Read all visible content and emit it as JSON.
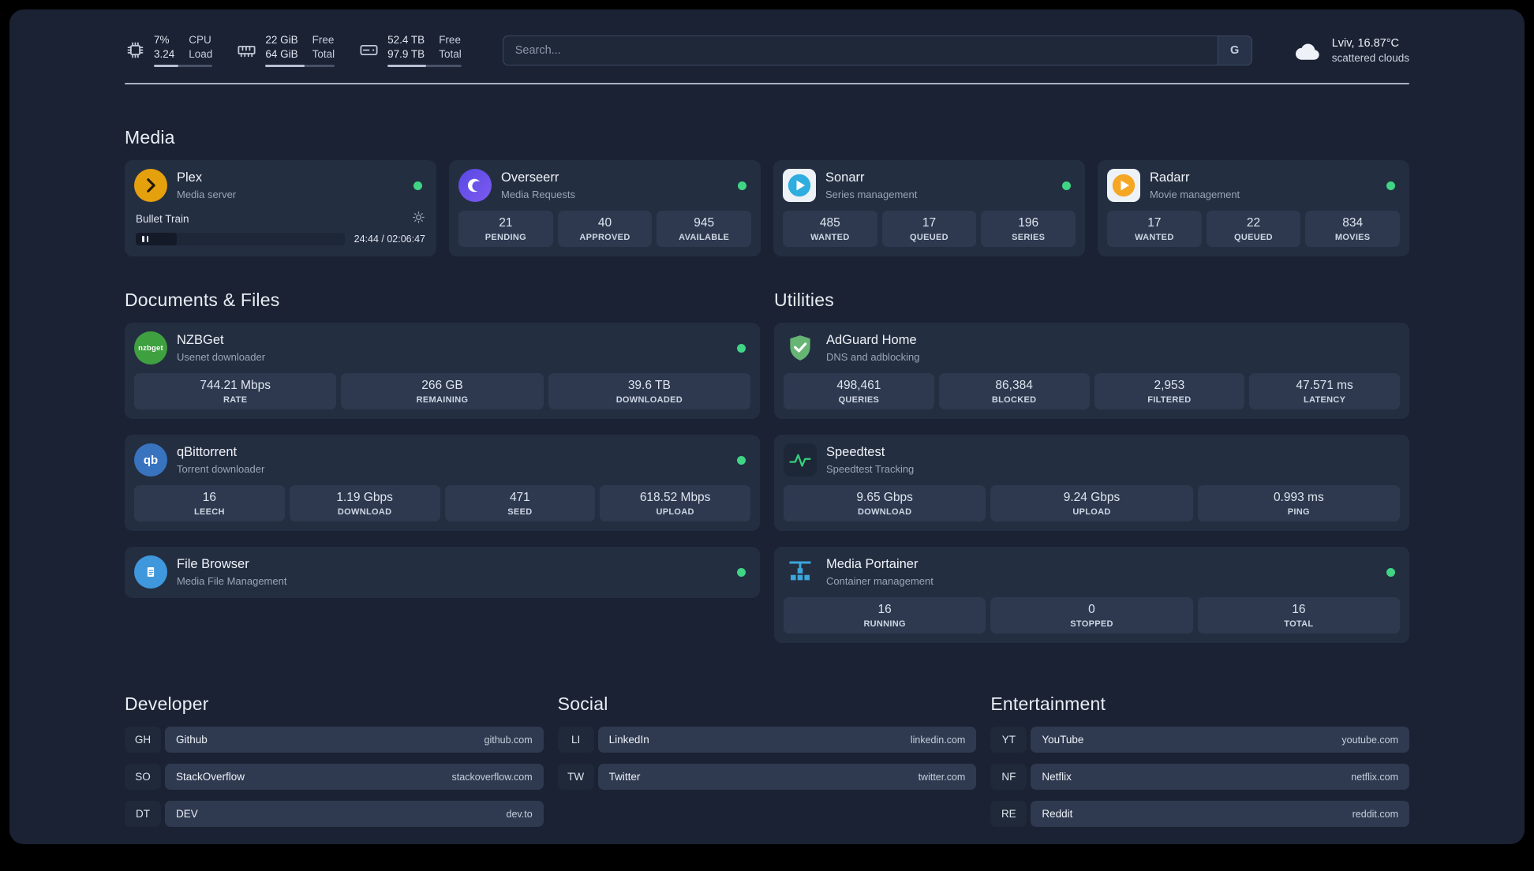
{
  "colors": {
    "status_online": "#3fd584",
    "background": "#1a2233",
    "card": "#242e41",
    "stat_tile": "#2e3950",
    "plex_accent": "#e5a00d"
  },
  "topbar": {
    "cpu": {
      "percent": "7%",
      "load": "3.24",
      "label_line1": "CPU",
      "label_line2": "Load",
      "bar_pct": 42
    },
    "memory": {
      "free": "22 GiB",
      "total": "64 GiB",
      "label_line1": "Free",
      "label_line2": "Total",
      "bar_pct": 57
    },
    "disk": {
      "free": "52.4 TB",
      "total": "97.9 TB",
      "label_line1": "Free",
      "label_line2": "Total",
      "bar_pct": 52
    },
    "search": {
      "placeholder": "Search...",
      "engine_button": "G"
    },
    "weather": {
      "location": "Lviv, 16.87°C",
      "condition": "scattered clouds"
    }
  },
  "sections": {
    "media": {
      "title": "Media",
      "plex": {
        "name": "Plex",
        "desc": "Media server",
        "now_playing": "Bullet Train",
        "time": "24:44 / 02:06:47",
        "progress_pct": 19.5
      },
      "overseerr": {
        "name": "Overseerr",
        "desc": "Media Requests",
        "stats": [
          {
            "value": "21",
            "label": "PENDING"
          },
          {
            "value": "40",
            "label": "APPROVED"
          },
          {
            "value": "945",
            "label": "AVAILABLE"
          }
        ]
      },
      "sonarr": {
        "name": "Sonarr",
        "desc": "Series management",
        "stats": [
          {
            "value": "485",
            "label": "WANTED"
          },
          {
            "value": "17",
            "label": "QUEUED"
          },
          {
            "value": "196",
            "label": "SERIES"
          }
        ]
      },
      "radarr": {
        "name": "Radarr",
        "desc": "Movie management",
        "stats": [
          {
            "value": "17",
            "label": "WANTED"
          },
          {
            "value": "22",
            "label": "QUEUED"
          },
          {
            "value": "834",
            "label": "MOVIES"
          }
        ]
      }
    },
    "documents": {
      "title": "Documents & Files",
      "nzbget": {
        "name": "NZBGet",
        "desc": "Usenet downloader",
        "icon_text": "nzbget",
        "stats": [
          {
            "value": "744.21 Mbps",
            "label": "RATE"
          },
          {
            "value": "266 GB",
            "label": "REMAINING"
          },
          {
            "value": "39.6 TB",
            "label": "DOWNLOADED"
          }
        ]
      },
      "qbittorrent": {
        "name": "qBittorrent",
        "desc": "Torrent downloader",
        "icon_text": "qb",
        "stats": [
          {
            "value": "16",
            "label": "LEECH"
          },
          {
            "value": "1.19 Gbps",
            "label": "DOWNLOAD"
          },
          {
            "value": "471",
            "label": "SEED"
          },
          {
            "value": "618.52 Mbps",
            "label": "UPLOAD"
          }
        ]
      },
      "filebrowser": {
        "name": "File Browser",
        "desc": "Media File Management"
      }
    },
    "utilities": {
      "title": "Utilities",
      "adguard": {
        "name": "AdGuard Home",
        "desc": "DNS and adblocking",
        "stats": [
          {
            "value": "498,461",
            "label": "QUERIES"
          },
          {
            "value": "86,384",
            "label": "BLOCKED"
          },
          {
            "value": "2,953",
            "label": "FILTERED"
          },
          {
            "value": "47.571 ms",
            "label": "LATENCY"
          }
        ]
      },
      "speedtest": {
        "name": "Speedtest",
        "desc": "Speedtest Tracking",
        "stats": [
          {
            "value": "9.65 Gbps",
            "label": "DOWNLOAD"
          },
          {
            "value": "9.24 Gbps",
            "label": "UPLOAD"
          },
          {
            "value": "0.993 ms",
            "label": "PING"
          }
        ]
      },
      "portainer": {
        "name": "Media Portainer",
        "desc": "Container management",
        "stats": [
          {
            "value": "16",
            "label": "RUNNING"
          },
          {
            "value": "0",
            "label": "STOPPED"
          },
          {
            "value": "16",
            "label": "TOTAL"
          }
        ]
      }
    }
  },
  "bookmarks": {
    "developer": {
      "title": "Developer",
      "items": [
        {
          "abbr": "GH",
          "name": "Github",
          "url": "github.com"
        },
        {
          "abbr": "SO",
          "name": "StackOverflow",
          "url": "stackoverflow.com"
        },
        {
          "abbr": "DT",
          "name": "DEV",
          "url": "dev.to"
        }
      ]
    },
    "social": {
      "title": "Social",
      "items": [
        {
          "abbr": "LI",
          "name": "LinkedIn",
          "url": "linkedin.com"
        },
        {
          "abbr": "TW",
          "name": "Twitter",
          "url": "twitter.com"
        }
      ]
    },
    "entertainment": {
      "title": "Entertainment",
      "items": [
        {
          "abbr": "YT",
          "name": "YouTube",
          "url": "youtube.com"
        },
        {
          "abbr": "NF",
          "name": "Netflix",
          "url": "netflix.com"
        },
        {
          "abbr": "RE",
          "name": "Reddit",
          "url": "reddit.com"
        }
      ]
    }
  }
}
